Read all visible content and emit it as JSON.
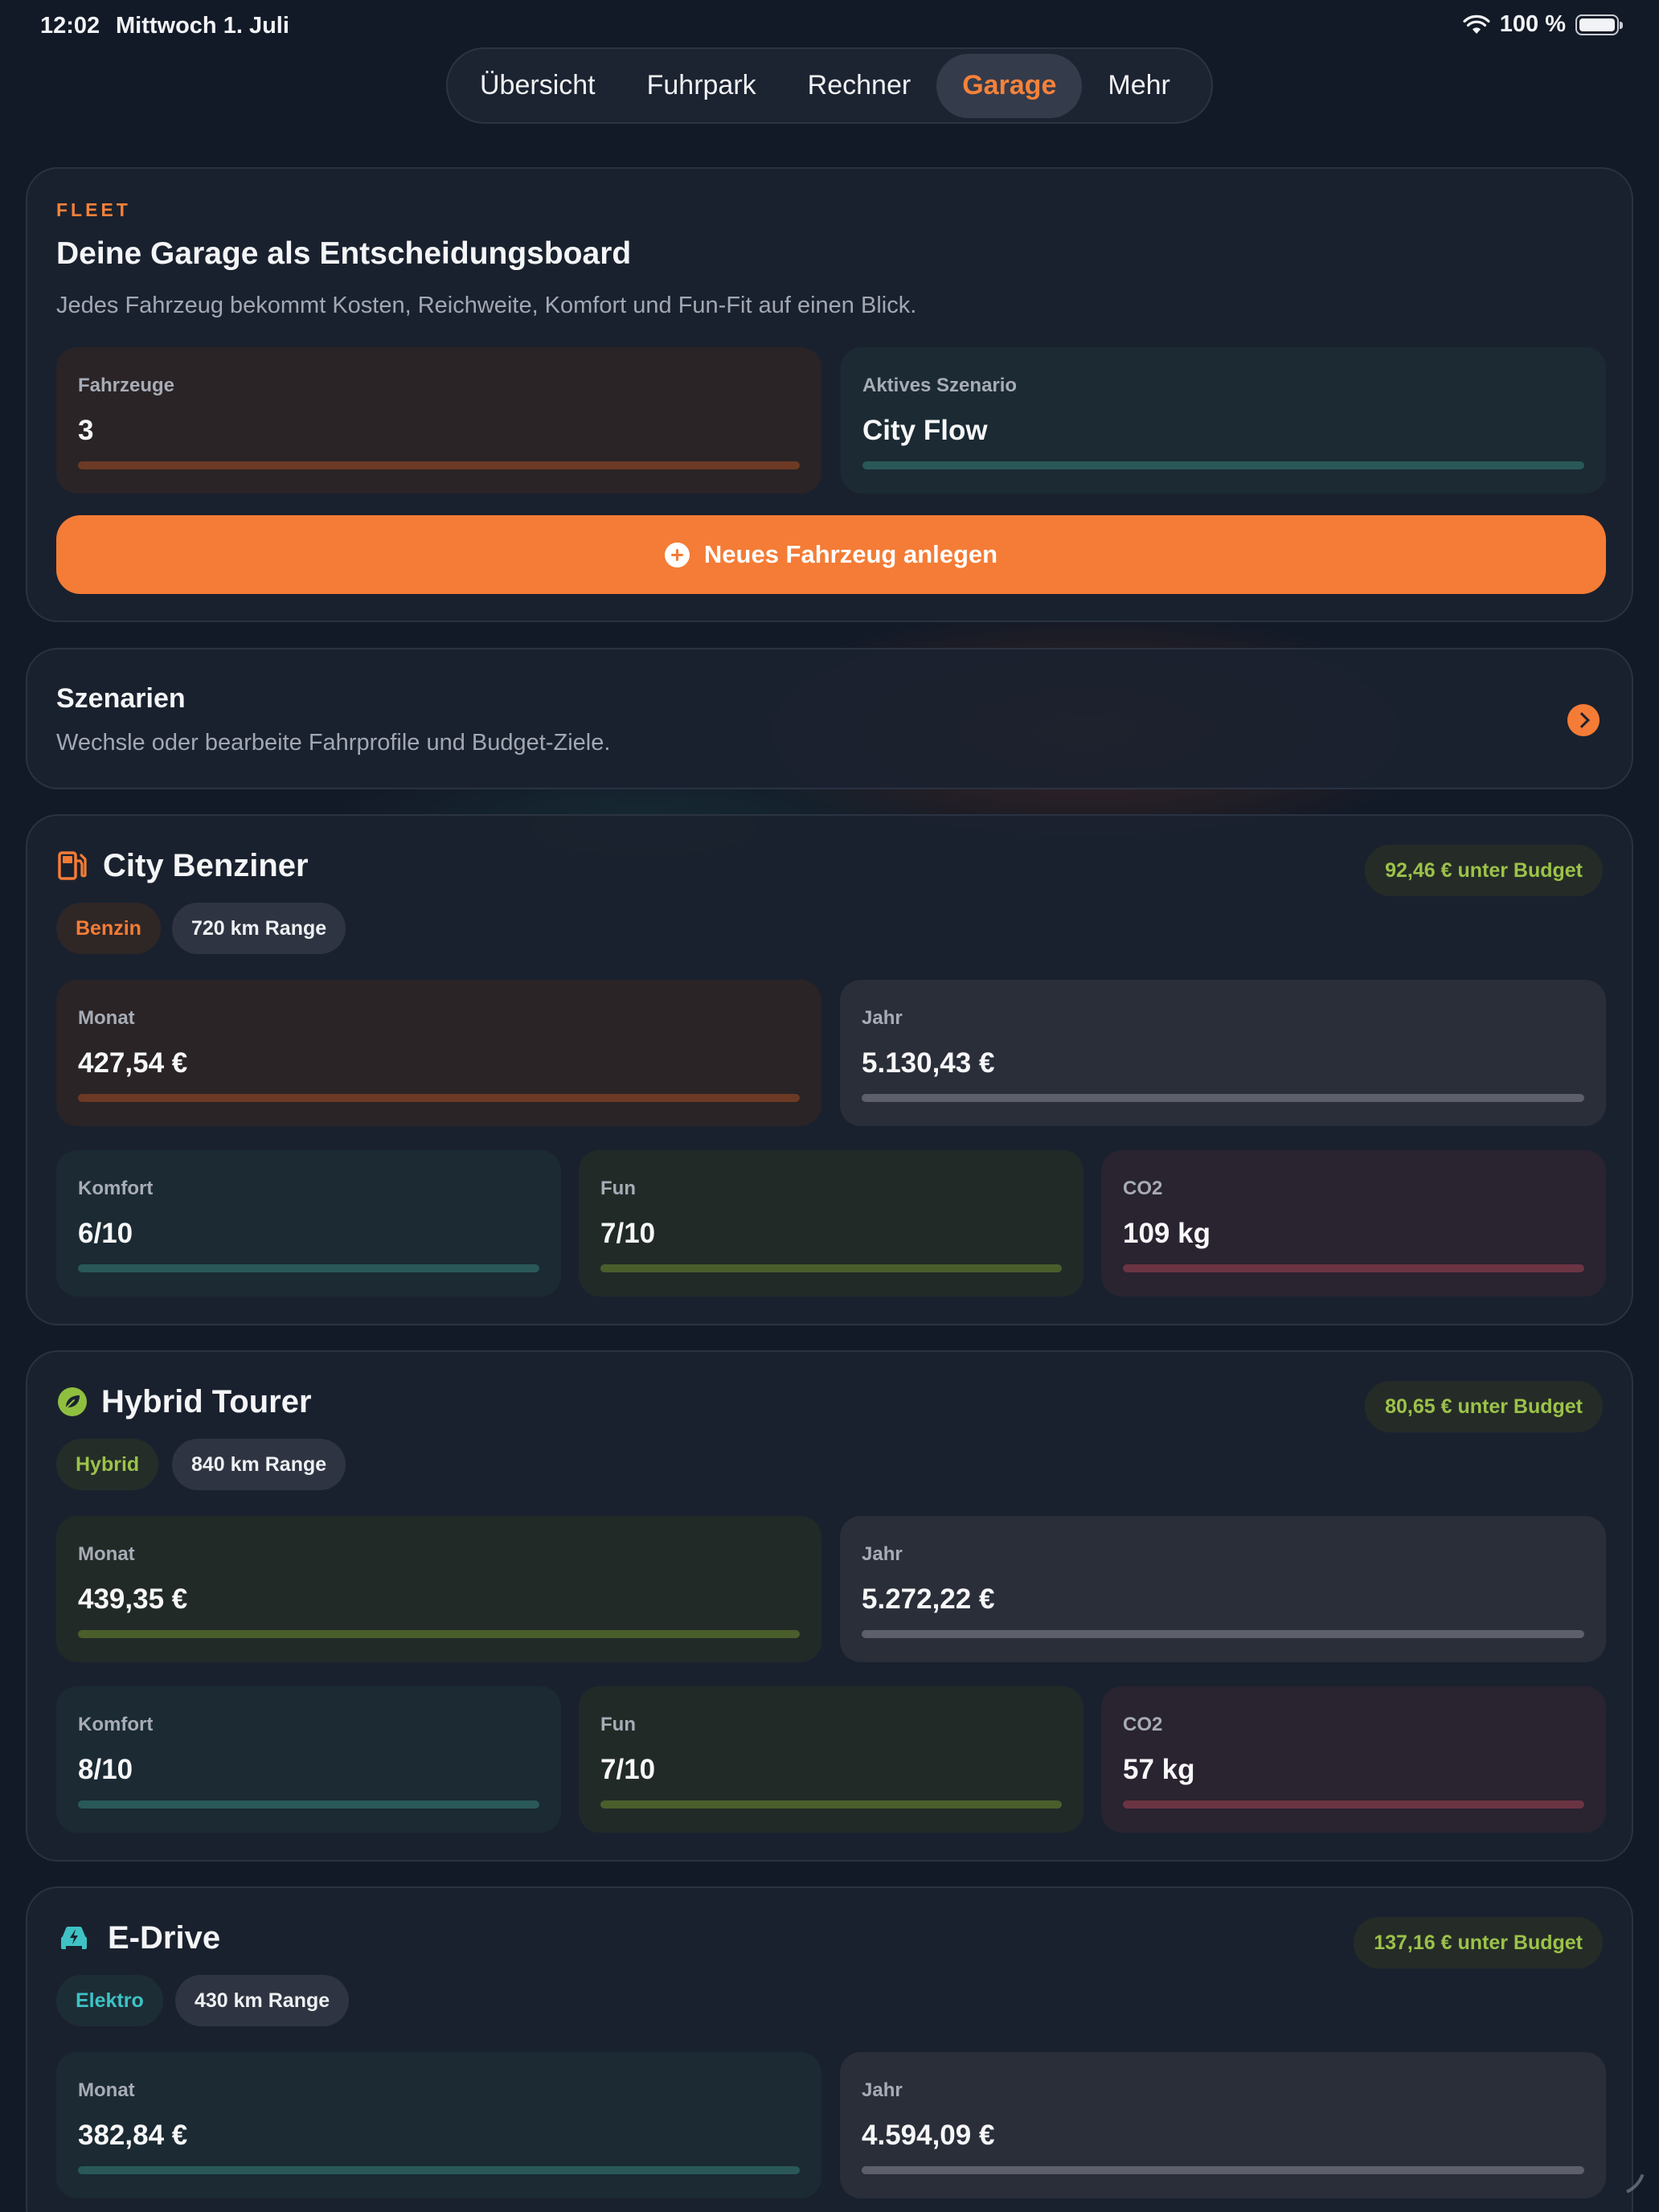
{
  "status_bar": {
    "time": "12:02",
    "date": "Mittwoch 1. Juli",
    "battery": "100 %"
  },
  "tabs": [
    {
      "label": "Übersicht",
      "active": false
    },
    {
      "label": "Fuhrpark",
      "active": false
    },
    {
      "label": "Rechner",
      "active": false
    },
    {
      "label": "Garage",
      "active": true
    },
    {
      "label": "Mehr",
      "active": false
    }
  ],
  "fleet": {
    "eyebrow": "FLEET",
    "title": "Deine Garage als Entscheidungsboard",
    "subtitle": "Jedes Fahrzeug bekommt Kosten, Reichweite, Komfort und Fun-Fit auf einen Blick.",
    "vehicles_label": "Fahrzeuge",
    "vehicles_value": "3",
    "scenario_label": "Aktives Szenario",
    "scenario_value": "City Flow",
    "cta_label": "Neues Fahrzeug anlegen"
  },
  "scenarios": {
    "title": "Szenarien",
    "subtitle": "Wechsle oder bearbeite Fahrprofile und Budget-Ziele."
  },
  "vehicles": [
    {
      "name": "City Benziner",
      "icon": "fuel-pump-icon",
      "budget": "92,46 € unter Budget",
      "fuel": "Benzin",
      "range": "720 km Range",
      "monat_label": "Monat",
      "monat": "427,54 €",
      "jahr_label": "Jahr",
      "jahr": "5.130,43 €",
      "komfort_label": "Komfort",
      "komfort": "6/10",
      "fun_label": "Fun",
      "fun": "7/10",
      "co2_label": "CO2",
      "co2": "109 kg"
    },
    {
      "name": "Hybrid Tourer",
      "icon": "leaf-icon",
      "budget": "80,65 € unter Budget",
      "fuel": "Hybrid",
      "range": "840 km Range",
      "monat_label": "Monat",
      "monat": "439,35 €",
      "jahr_label": "Jahr",
      "jahr": "5.272,22 €",
      "komfort_label": "Komfort",
      "komfort": "8/10",
      "fun_label": "Fun",
      "fun": "7/10",
      "co2_label": "CO2",
      "co2": "57 kg"
    },
    {
      "name": "E-Drive",
      "icon": "electric-car-icon",
      "budget": "137,16 € unter Budget",
      "fuel": "Elektro",
      "range": "430 km Range",
      "monat_label": "Monat",
      "monat": "382,84 €",
      "jahr_label": "Jahr",
      "jahr": "4.594,09 €"
    }
  ],
  "colors": {
    "accent": "#f47c36",
    "green": "#9cc24a",
    "teal": "#3fc2c4",
    "background": "#131a27"
  }
}
